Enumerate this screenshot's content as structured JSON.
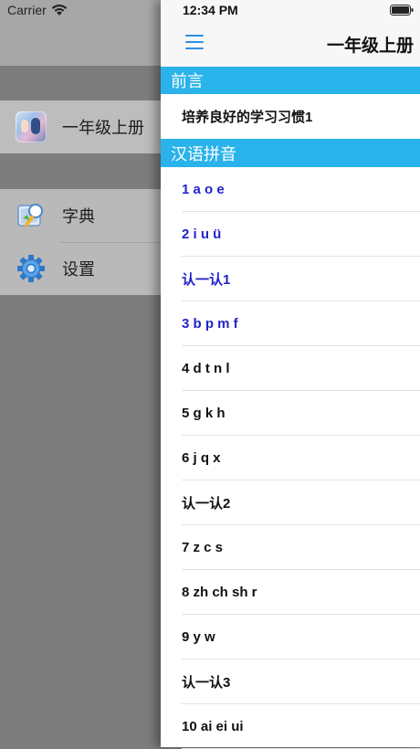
{
  "status_bar": {
    "carrier": "Carrier",
    "time": "12:34 PM"
  },
  "drawer": {
    "current_book": {
      "label": "一年级上册",
      "icon": "book-cover-icon"
    },
    "menu": [
      {
        "label": "字典",
        "icon": "dictionary-icon"
      },
      {
        "label": "设置",
        "icon": "gear-icon"
      }
    ]
  },
  "nav": {
    "title": "一年级上册",
    "menu_icon": "hamburger-menu-icon"
  },
  "sections": [
    {
      "header": "前言",
      "items": [
        {
          "label": "培养良好的学习习惯1"
        }
      ]
    },
    {
      "header": "汉语拼音"
    }
  ],
  "lessons": [
    {
      "label": "1 a o e",
      "read": true
    },
    {
      "label": "2 i u ü",
      "read": true
    },
    {
      "label": "认一认1",
      "read": true
    },
    {
      "label": "3 b p m f",
      "read": true
    },
    {
      "label": "4 d t n l",
      "read": false
    },
    {
      "label": "5 g k h",
      "read": false
    },
    {
      "label": "6 j q x",
      "read": false
    },
    {
      "label": "认一认2",
      "read": false
    },
    {
      "label": "7 z c s",
      "read": false
    },
    {
      "label": "8 zh ch sh r",
      "read": false
    },
    {
      "label": "9 y w",
      "read": false
    },
    {
      "label": "认一认3",
      "read": false
    },
    {
      "label": "10 ai ei ui",
      "read": false
    }
  ],
  "colors": {
    "section_header": "#2ab2ea",
    "read_link": "#2323c8",
    "nav_icon": "#2f8fe8"
  }
}
